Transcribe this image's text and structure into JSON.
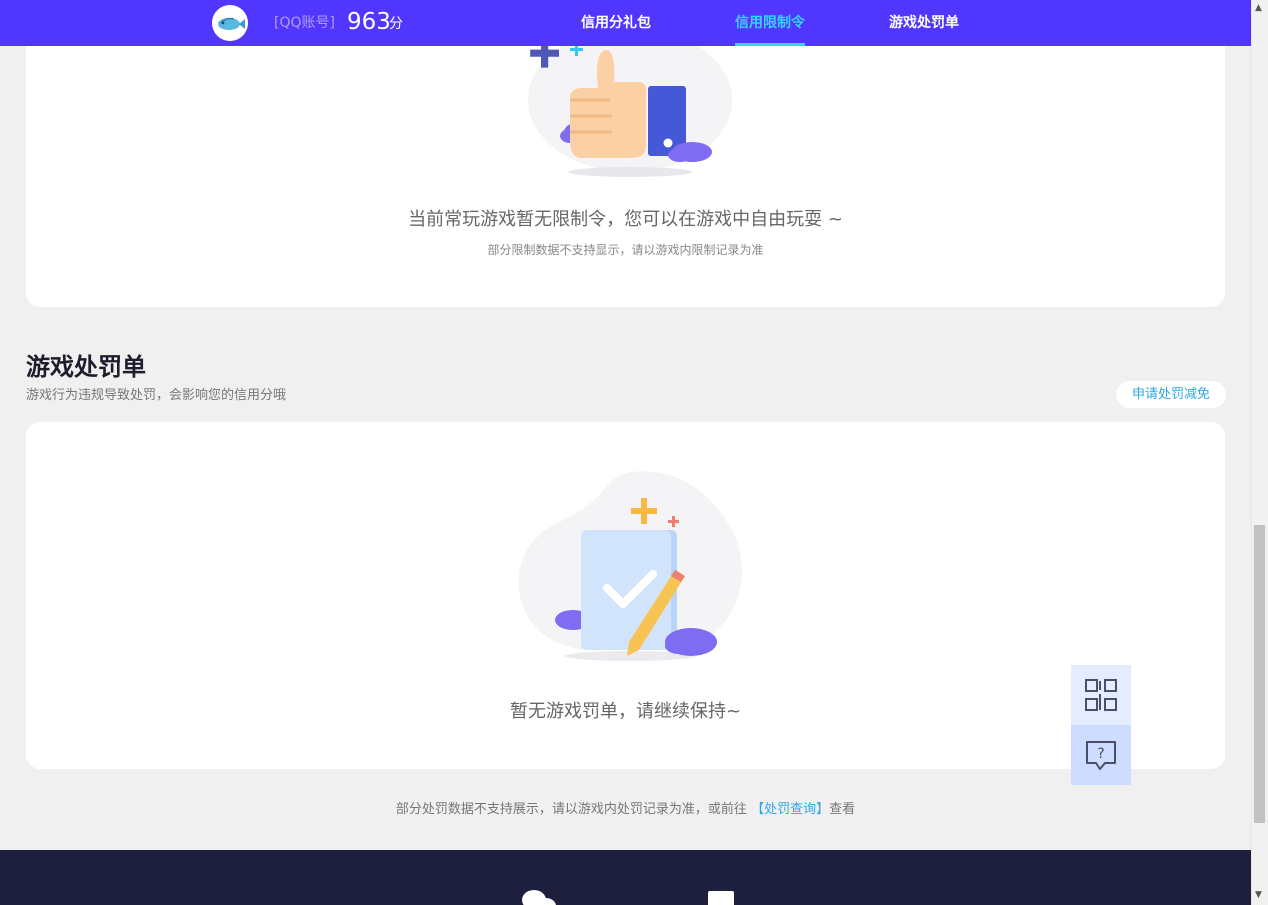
{
  "header": {
    "account_label": "[QQ账号]",
    "score": "963",
    "score_unit": "分",
    "nav": [
      {
        "label": "信用分礼包",
        "active": false
      },
      {
        "label": "信用限制令",
        "active": true
      },
      {
        "label": "游戏处罚单",
        "active": false
      }
    ]
  },
  "restriction": {
    "empty_title": "当前常玩游戏暂无限制令，您可以在游戏中自由玩耍 ~",
    "empty_subtitle": "部分限制数据不支持显示，请以游戏内限制记录为准"
  },
  "penalty": {
    "title": "游戏处罚单",
    "subtitle": "游戏行为违规导致处罚，会影响您的信用分哦",
    "appeal_button": "申请处罚减免",
    "empty_title": "暂无游戏罚单，请继续保持~",
    "footnote_prefix": "部分处罚数据不支持展示，请以游戏内处罚记录为准，或前往",
    "footnote_link": "【处罚查询】",
    "footnote_suffix": "查看"
  },
  "colors": {
    "brand": "#5136ff",
    "nav_active": "#35d3ff",
    "link": "#2ea8e6",
    "footer": "#1e1f3d"
  },
  "icons": {
    "avatar": "fish-avatar-icon",
    "restriction_illustration": "thumbs-up-illustration-icon",
    "penalty_illustration": "checklist-pencil-illustration-icon",
    "qr": "qr-code-icon",
    "help": "help-chat-icon"
  }
}
